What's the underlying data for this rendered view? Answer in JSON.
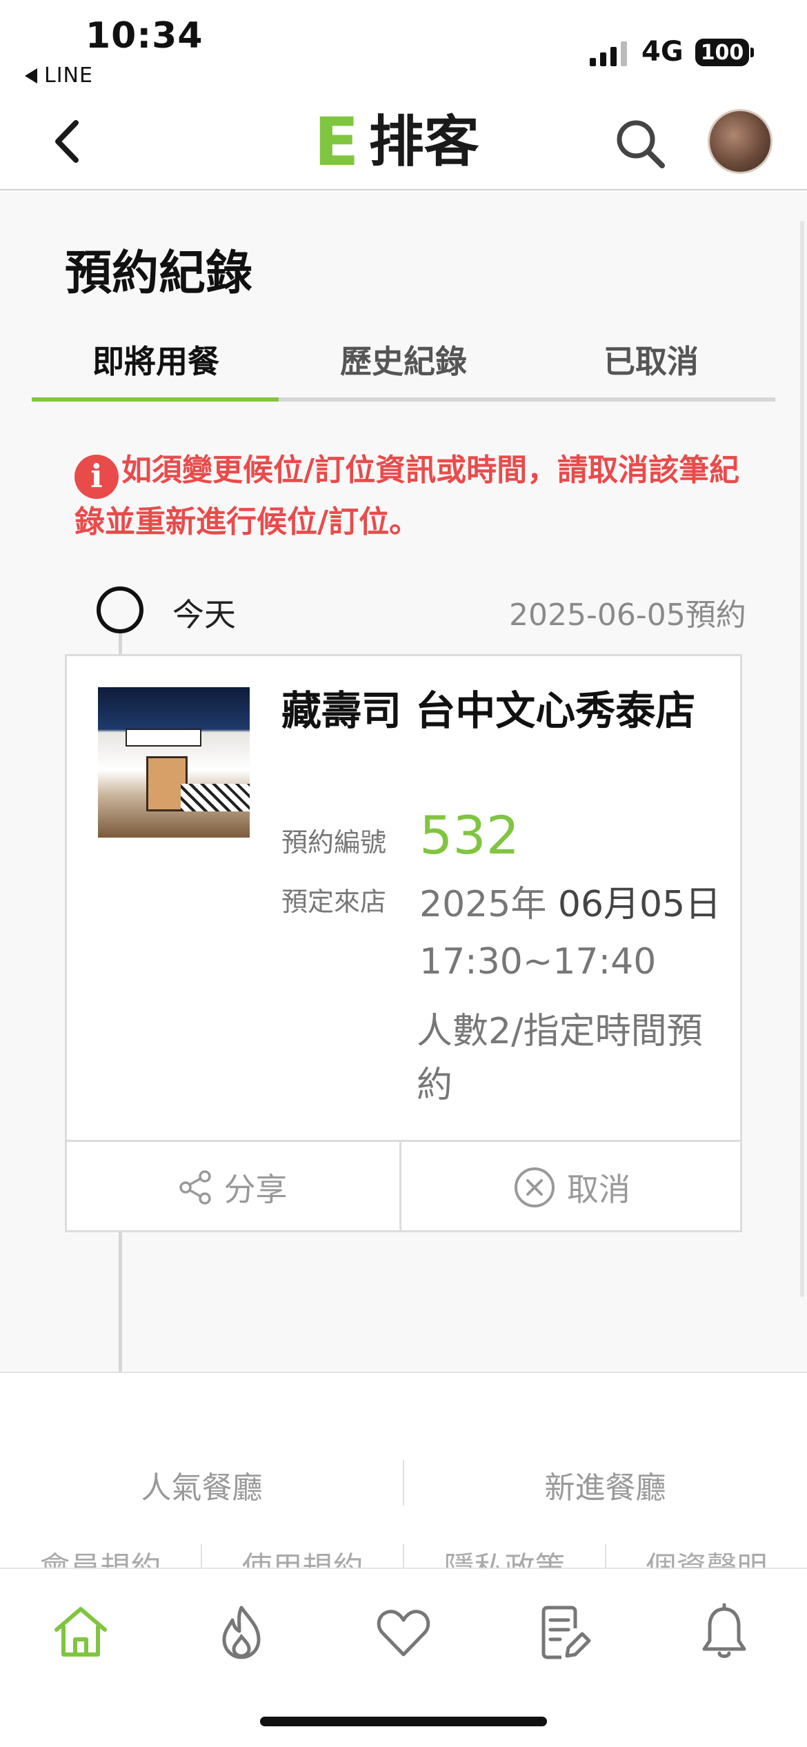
{
  "status_bar": {
    "time": "10:34",
    "back_app": "LINE",
    "network": "4G",
    "battery": "100"
  },
  "header": {
    "logo_letter": "E",
    "logo_text": "排客"
  },
  "page": {
    "title": "預約紀錄"
  },
  "tabs": [
    {
      "label": "即將用餐",
      "active": true
    },
    {
      "label": "歷史紀錄",
      "active": false
    },
    {
      "label": "已取消",
      "active": false
    }
  ],
  "notice": {
    "icon": "i",
    "text": "如須變更候位/訂位資訊或時間，請取消該筆紀錄並重新進行候位/訂位。"
  },
  "timeline": {
    "day_label": "今天",
    "reserve_date": "2025-06-05預約"
  },
  "booking": {
    "shop_name": "藏壽司 台中文心秀泰店",
    "label_number": "預約編號",
    "number": "532",
    "label_arrival": "預定來店",
    "date_year": "2025年",
    "date_md": "06月05日",
    "time_range": "17:30~17:40",
    "people": "人數2/指定時間預約",
    "share_label": "分享",
    "cancel_label": "取消"
  },
  "footer": {
    "links_row1": [
      "人氣餐廳",
      "新進餐廳"
    ],
    "links_row2": [
      "會員規約",
      "使用規約",
      "隱私政策",
      "個資聲明"
    ]
  },
  "bottom_nav": [
    {
      "icon": "home-icon",
      "active": true
    },
    {
      "icon": "flame-icon",
      "active": false
    },
    {
      "icon": "heart-icon",
      "active": false
    },
    {
      "icon": "records-icon",
      "active": false
    },
    {
      "icon": "bell-icon",
      "active": false
    }
  ],
  "colors": {
    "accent": "#80c53f",
    "alert": "#e94b4b"
  }
}
